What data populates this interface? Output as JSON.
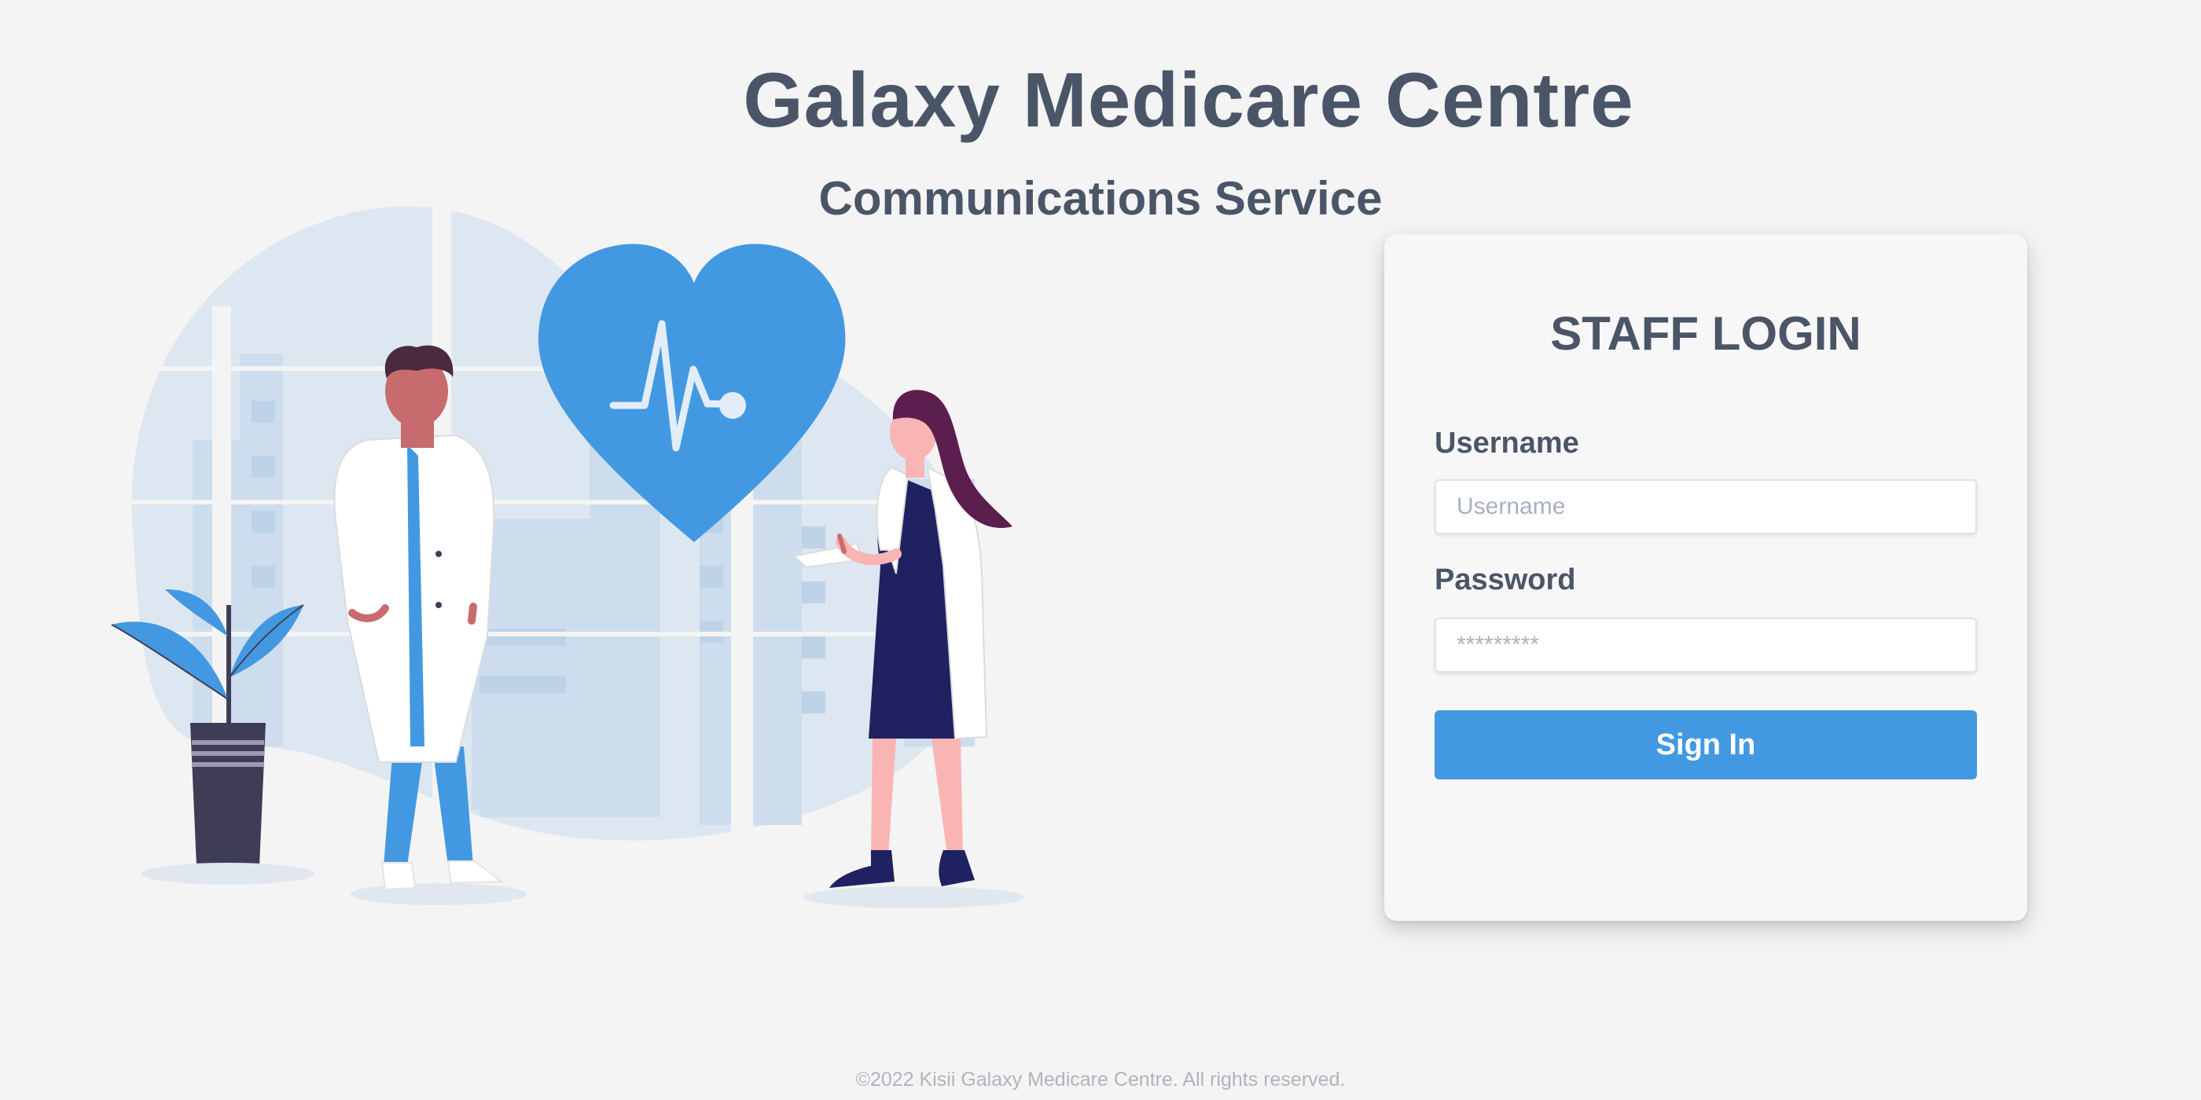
{
  "header": {
    "title": "Galaxy Medicare Centre",
    "subtitle": "Communications Service"
  },
  "illustration": {
    "description_icon": "doctors-heart-illustration",
    "colors": {
      "accent": "#4399e1",
      "background_blob": "#d8e5f1",
      "background_buildings": "#c5d8ec",
      "pot": "#3f3d56",
      "navy": "#1f2160",
      "hair_dark": "#4a2a3f",
      "hair_purple": "#5c1d4f",
      "skin_light": "#f9b4b4",
      "skin_dark": "#c86b6e",
      "coat": "#ffffff"
    }
  },
  "login": {
    "heading": "STAFF LOGIN",
    "username_label": "Username",
    "username_placeholder": "Username",
    "username_value": "",
    "password_label": "Password",
    "password_placeholder": "*********",
    "password_value": "",
    "sign_in_label": "Sign In"
  },
  "footer": {
    "text": "©2022 Kisii Galaxy Medicare Centre. All rights reserved."
  },
  "colors": {
    "page_background": "#f4f4f4",
    "text_primary": "#4a5568",
    "button": "#4399e1",
    "footer_text": "#b0b4bc"
  }
}
